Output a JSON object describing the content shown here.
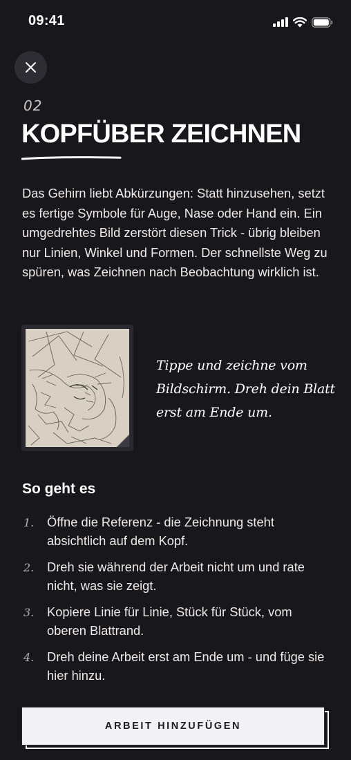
{
  "status": {
    "time": "09:41"
  },
  "header": {
    "step_number": "02",
    "title": "KOPFÜBER ZEICHNEN"
  },
  "intro": "Das Gehirn liebt Abkürzungen: Statt hinzusehen, setzt es fertige Symbole für Auge, Nase oder Hand ein. Ein umgedrehtes Bild zerstört diesen Trick - übrig bleiben nur Linien, Winkel und Formen. Der schnellste Weg zu spüren, was Zeichnen nach Beobachtung wirklich ist.",
  "hint": "Tippe und zeichne vom Bildschirm. Dreh dein Blatt erst am Ende um.",
  "how_to": {
    "heading": "So geht es",
    "steps": [
      {
        "num": "1.",
        "text": "Öffne die Referenz - die Zeichnung steht absichtlich auf dem Kopf."
      },
      {
        "num": "2.",
        "text": "Dreh sie während der Arbeit nicht um und rate nicht, was sie zeigt."
      },
      {
        "num": "3.",
        "text": "Kopiere Linie für Linie, Stück für Stück, vom oberen Blattrand."
      },
      {
        "num": "4.",
        "text": "Dreh deine Arbeit erst am Ende um - und füge sie hier hinzu."
      }
    ]
  },
  "cta": {
    "label": "ARBEIT HINZUFÜGEN"
  },
  "icons": {
    "close": "close-icon",
    "signal": "cellular-signal-icon",
    "wifi": "wifi-icon",
    "battery": "battery-icon"
  },
  "colors": {
    "background": "#18171c",
    "text": "#f2f1ef",
    "button": "#f2f1f3",
    "paper": "#d8d1c3"
  }
}
